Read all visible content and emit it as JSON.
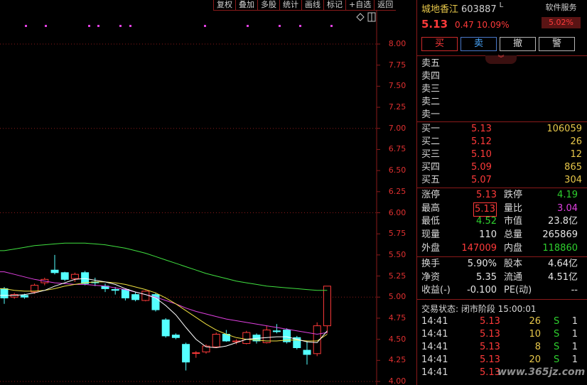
{
  "toolbar": [
    "复权",
    "叠加",
    "多股",
    "统计",
    "画线",
    "标记",
    "+自选",
    "返回"
  ],
  "colors": {
    "up": "#ff3a3a",
    "down": "#54ffff",
    "ma5": "#ffffff",
    "ma10": "#f0e040",
    "ma20": "#e040e0",
    "ma60": "#40e040",
    "grid": "#8a1a1a"
  },
  "chart_data": {
    "type": "candlestick",
    "ylim": [
      4.0,
      8.2
    ],
    "yticks": [
      "8.00",
      "7.75",
      "7.50",
      "7.25",
      "7.00",
      "6.75",
      "6.50",
      "6.25",
      "6.00",
      "5.75",
      "5.50",
      "5.25",
      "5.00",
      "4.75",
      "4.50",
      "4.25",
      "4.00"
    ],
    "candles": [
      {
        "o": 5.1,
        "c": 4.99,
        "h": 5.12,
        "l": 4.92
      },
      {
        "o": 5.0,
        "c": 5.03,
        "h": 5.05,
        "l": 4.98
      },
      {
        "o": 5.02,
        "c": 5.0,
        "h": 5.04,
        "l": 4.98
      },
      {
        "o": 5.06,
        "c": 5.14,
        "h": 5.16,
        "l": 5.04
      },
      {
        "o": 5.17,
        "c": 5.21,
        "h": 5.23,
        "l": 5.14
      },
      {
        "o": 5.32,
        "c": 5.29,
        "h": 5.5,
        "l": 5.27
      },
      {
        "o": 5.29,
        "c": 5.21,
        "h": 5.3,
        "l": 5.19
      },
      {
        "o": 5.22,
        "c": 5.27,
        "h": 5.29,
        "l": 5.18
      },
      {
        "o": 5.29,
        "c": 5.16,
        "h": 5.31,
        "l": 5.14
      },
      {
        "o": 5.18,
        "c": 5.17,
        "h": 5.23,
        "l": 5.13
      },
      {
        "o": 5.13,
        "c": 5.1,
        "h": 5.16,
        "l": 5.06
      },
      {
        "o": 5.09,
        "c": 5.08,
        "h": 5.12,
        "l": 5.03
      },
      {
        "o": 5.09,
        "c": 4.99,
        "h": 5.1,
        "l": 4.96
      },
      {
        "o": 5.03,
        "c": 4.97,
        "h": 5.06,
        "l": 4.95
      },
      {
        "o": 4.96,
        "c": 5.07,
        "h": 5.08,
        "l": 4.95
      },
      {
        "o": 5.03,
        "c": 4.85,
        "h": 5.05,
        "l": 4.83
      },
      {
        "o": 4.73,
        "c": 4.54,
        "h": 4.75,
        "l": 4.52
      },
      {
        "o": 4.55,
        "c": 4.52,
        "h": 4.57,
        "l": 4.5
      },
      {
        "o": 4.44,
        "c": 4.23,
        "h": 4.46,
        "l": 4.13
      },
      {
        "o": 4.34,
        "c": 4.34,
        "h": 4.36,
        "l": 4.28
      },
      {
        "o": 4.35,
        "c": 4.42,
        "h": 4.44,
        "l": 4.33
      },
      {
        "o": 4.41,
        "c": 4.56,
        "h": 4.58,
        "l": 4.4
      },
      {
        "o": 4.56,
        "c": 4.48,
        "h": 4.61,
        "l": 4.47
      },
      {
        "o": 4.47,
        "c": 4.48,
        "h": 4.5,
        "l": 4.44
      },
      {
        "o": 4.45,
        "c": 4.58,
        "h": 4.6,
        "l": 4.44
      },
      {
        "o": 4.55,
        "c": 4.48,
        "h": 4.57,
        "l": 4.45
      },
      {
        "o": 4.46,
        "c": 4.61,
        "h": 4.66,
        "l": 4.45
      },
      {
        "o": 4.6,
        "c": 4.59,
        "h": 4.68,
        "l": 4.57
      },
      {
        "o": 4.61,
        "c": 4.47,
        "h": 4.63,
        "l": 4.45
      },
      {
        "o": 4.52,
        "c": 4.4,
        "h": 4.54,
        "l": 4.38
      },
      {
        "o": 4.37,
        "c": 4.32,
        "h": 4.48,
        "l": 4.2
      },
      {
        "o": 4.33,
        "c": 4.66,
        "h": 4.7,
        "l": 4.3
      },
      {
        "o": 4.66,
        "c": 5.13,
        "h": 5.13,
        "l": 4.57
      }
    ],
    "ma5": [
      5.02,
      5.02,
      5.03,
      5.05,
      5.08,
      5.13,
      5.17,
      5.21,
      5.22,
      5.2,
      5.18,
      5.15,
      5.1,
      5.06,
      5.03,
      4.99,
      4.9,
      4.79,
      4.64,
      4.5,
      4.41,
      4.4,
      4.42,
      4.46,
      4.5,
      4.51,
      4.52,
      4.53,
      4.53,
      4.5,
      4.47,
      4.46,
      4.6
    ],
    "ma10": [
      5.1,
      5.08,
      5.07,
      5.07,
      5.08,
      5.1,
      5.13,
      5.15,
      5.17,
      5.18,
      5.18,
      5.17,
      5.15,
      5.12,
      5.09,
      5.05,
      4.99,
      4.92,
      4.84,
      4.76,
      4.68,
      4.61,
      4.56,
      4.52,
      4.5,
      4.49,
      4.48,
      4.48,
      4.49,
      4.49,
      4.48,
      4.48,
      4.56
    ],
    "ma20": [
      5.3,
      5.27,
      5.24,
      5.21,
      5.19,
      5.17,
      5.16,
      5.15,
      5.15,
      5.14,
      5.13,
      5.11,
      5.09,
      5.06,
      5.03,
      5.0,
      4.96,
      4.92,
      4.87,
      4.83,
      4.8,
      4.77,
      4.74,
      4.72,
      4.7,
      4.68,
      4.66,
      4.64,
      4.62,
      4.6,
      4.58,
      4.56,
      4.58
    ],
    "ma60": [
      5.55,
      5.57,
      5.59,
      5.61,
      5.62,
      5.63,
      5.64,
      5.64,
      5.64,
      5.63,
      5.62,
      5.6,
      5.58,
      5.55,
      5.52,
      5.48,
      5.44,
      5.4,
      5.36,
      5.32,
      5.28,
      5.25,
      5.22,
      5.19,
      5.17,
      5.15,
      5.13,
      5.12,
      5.11,
      5.1,
      5.09,
      5.08,
      5.08
    ]
  },
  "stock": {
    "name": "城地香江",
    "code": "603887",
    "mark": "L",
    "price": "5.13",
    "change": "0.47",
    "change_pct": "10.09%",
    "service_label": "软件服务",
    "service_pct": "5.02%"
  },
  "actions": [
    "买",
    "卖",
    "撤",
    "警"
  ],
  "sell_orders": [
    {
      "label": "卖五",
      "price": "",
      "vol": ""
    },
    {
      "label": "卖四",
      "price": "",
      "vol": ""
    },
    {
      "label": "卖三",
      "price": "",
      "vol": ""
    },
    {
      "label": "卖二",
      "price": "",
      "vol": ""
    },
    {
      "label": "卖一",
      "price": "",
      "vol": ""
    }
  ],
  "buy_orders": [
    {
      "label": "买一",
      "price": "5.13",
      "vol": "106059"
    },
    {
      "label": "买二",
      "price": "5.12",
      "vol": "26"
    },
    {
      "label": "买三",
      "price": "5.10",
      "vol": "12"
    },
    {
      "label": "买四",
      "price": "5.09",
      "vol": "865"
    },
    {
      "label": "买五",
      "price": "5.07",
      "vol": "304"
    }
  ],
  "stats": {
    "limit_up_label": "涨停",
    "limit_up": "5.13",
    "limit_down_label": "跌停",
    "limit_down": "4.19",
    "high_label": "最高",
    "high": "5.13",
    "vol_ratio_label": "量比",
    "vol_ratio": "3.04",
    "low_label": "最低",
    "low": "4.52",
    "mkt_cap_label": "市值",
    "mkt_cap": "23.8亿",
    "cur_vol_label": "现量",
    "cur_vol": "110",
    "total_vol_label": "总量",
    "total_vol": "265869",
    "outer_label": "外盘",
    "outer": "147009",
    "inner_label": "内盘",
    "inner": "118860",
    "turnover_label": "换手",
    "turnover": "5.90%",
    "equity_label": "股本",
    "equity": "4.64亿",
    "nav_label": "净资",
    "nav": "5.35",
    "float_label": "流通",
    "float": "4.51亿",
    "eps_label": "收益(-)",
    "eps": "-0.100",
    "pe_label": "PE(动)",
    "pe": "--"
  },
  "trade_status": "交易状态: 闭市阶段 15:00:01",
  "ticks": [
    {
      "time": "14:41",
      "price": "5.13",
      "vol": "26",
      "side": "S",
      "num": "1"
    },
    {
      "time": "14:41",
      "price": "5.13",
      "vol": "10",
      "side": "S",
      "num": "1"
    },
    {
      "time": "14:41",
      "price": "5.13",
      "vol": "8",
      "side": "S",
      "num": "1"
    },
    {
      "time": "14:41",
      "price": "5.13",
      "vol": "20",
      "side": "S",
      "num": "1"
    },
    {
      "time": "14:41",
      "price": "5.13",
      "vol": "",
      "side": "",
      "num": ""
    }
  ],
  "watermark": "www.365jz.com"
}
